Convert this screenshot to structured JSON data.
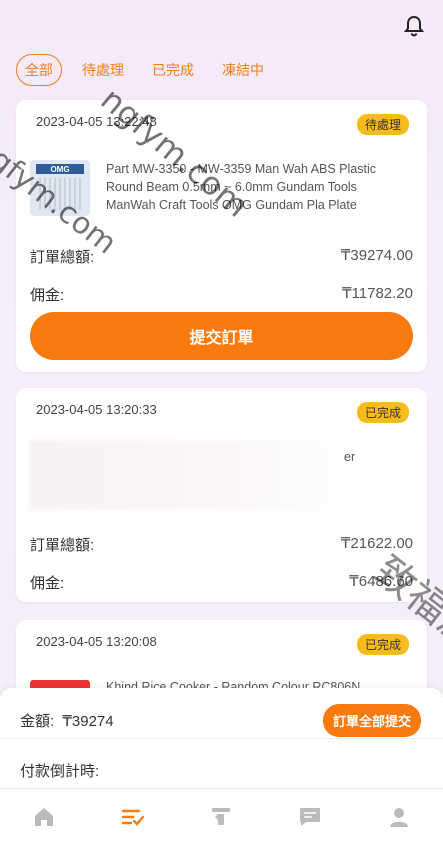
{
  "tabs": [
    {
      "label": "全部",
      "active": true
    },
    {
      "label": "待處理",
      "active": false
    },
    {
      "label": "已完成",
      "active": false
    },
    {
      "label": "凍結中",
      "active": false
    }
  ],
  "orders": [
    {
      "time": "2023-04-05 13:22:48",
      "status": "待處理",
      "thumb_text": "OMG",
      "title": "Part MW-3350 - MW-3359 Man Wah ABS Plastic Round Beam 0.5mm ~ 6.0mm Gundam Tools ManWah Craft Tools OMG Gundam Pla Plate",
      "total_label": "訂單總額:",
      "total_value": "₸39274.00",
      "commission_label": "佣金:",
      "commission_value": "₸11782.20",
      "submit_label": "提交訂單"
    },
    {
      "time": "2023-04-05 13:20:33",
      "status": "已完成",
      "title": "er",
      "total_label": "訂單總額:",
      "total_value": "₸21622.00",
      "commission_label": "佣金:",
      "commission_value": "₸6486.60"
    },
    {
      "time": "2023-04-05 13:20:08",
      "status": "已完成",
      "title": "Khind Rice Cooker - Random Colour RC806N"
    }
  ],
  "summary": {
    "amount_label": "金額:",
    "amount_value": "₸39274",
    "countdown_label": "付款倒計時:",
    "submit_all_label": "訂單全部提交"
  },
  "watermarks": {
    "top": "ngfym.com",
    "left": "ngfym.com",
    "right": "致福源码"
  },
  "colors": {
    "accent": "#f97b10",
    "badge": "#f7bb1e"
  },
  "icons": {
    "bell": "bell-icon",
    "nav": [
      "home-icon",
      "orders-icon",
      "withdraw-icon",
      "message-icon",
      "user-icon"
    ],
    "active_nav": "orders-icon"
  }
}
